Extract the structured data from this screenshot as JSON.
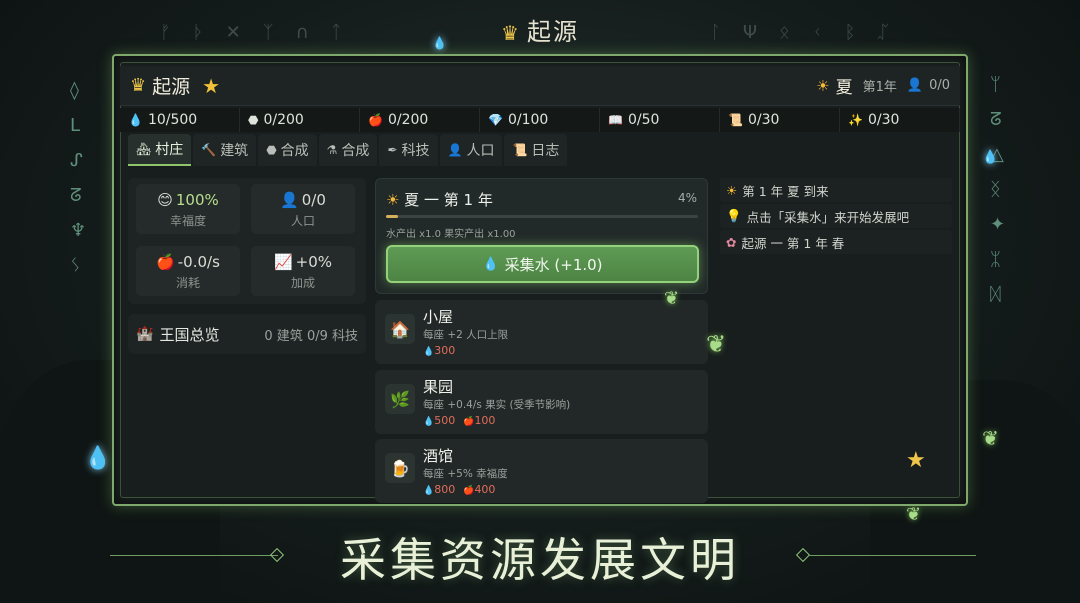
{
  "top": {
    "title": "起源"
  },
  "header": {
    "title": "起源",
    "season": "夏",
    "year": "第1年",
    "population": "0/0"
  },
  "resources": [
    {
      "icon": "water-drop-icon",
      "glyph": "💧",
      "value": "10/500"
    },
    {
      "icon": "stone-icon",
      "glyph": "⬣",
      "value": "0/200"
    },
    {
      "icon": "apple-icon",
      "glyph": "🍎",
      "value": "0/200"
    },
    {
      "icon": "gem-icon",
      "glyph": "💎",
      "value": "0/100"
    },
    {
      "icon": "book-icon",
      "glyph": "📖",
      "value": "0/50"
    },
    {
      "icon": "scroll-icon",
      "glyph": "📜",
      "value": "0/30"
    },
    {
      "icon": "sparkle-icon",
      "glyph": "✨",
      "value": "0/30"
    }
  ],
  "tabs": [
    {
      "label": "村庄",
      "icon": "village-icon"
    },
    {
      "label": "建筑",
      "icon": "hammer-icon"
    },
    {
      "label": "合成",
      "icon": "cauldron-icon"
    },
    {
      "label": "合成",
      "icon": "flask-icon"
    },
    {
      "label": "科技",
      "icon": "quill-icon"
    },
    {
      "label": "人口",
      "icon": "person-icon"
    },
    {
      "label": "日志",
      "icon": "journal-icon"
    }
  ],
  "stats": [
    {
      "value": "100%",
      "label": "幸福度",
      "icon": "smile-icon"
    },
    {
      "value": "0/0",
      "label": "人口",
      "icon": "person-icon"
    },
    {
      "value": "-0.0/s",
      "label": "消耗",
      "icon": "apple-icon"
    },
    {
      "value": "+0%",
      "label": "加成",
      "icon": "trend-icon"
    }
  ],
  "kingdom": {
    "title": "王国总览",
    "summary": "0 建筑  0/9 科技"
  },
  "season_card": {
    "title": "夏 一 第 1 年",
    "percent": "4%",
    "progress": 0.04,
    "production": "水产出 x1.0   果实产出 x1.00",
    "collect_label": "采集水 (+1.0)"
  },
  "buildings": [
    {
      "name": "小屋",
      "desc": "每座 +2 人口上限",
      "icon": "house-icon",
      "glyph": "🏠",
      "costs": [
        {
          "type": "water",
          "value": "300",
          "red": true
        }
      ]
    },
    {
      "name": "果园",
      "desc": "每座 +0.4/s 果实 (受季节影响)",
      "icon": "sprout-icon",
      "glyph": "🌿",
      "costs": [
        {
          "type": "water",
          "value": "500",
          "red": true
        },
        {
          "type": "apple",
          "value": "100",
          "red": true
        }
      ]
    },
    {
      "name": "酒馆",
      "desc": "每座 +5% 幸福度",
      "icon": "beer-icon",
      "glyph": "🍺",
      "costs": [
        {
          "type": "water",
          "value": "800",
          "red": true
        },
        {
          "type": "apple",
          "value": "400",
          "red": true
        }
      ]
    }
  ],
  "log": [
    {
      "icon": "sun-icon",
      "glyph": "☀",
      "text": "第 1 年 夏 到来"
    },
    {
      "icon": "bulb-icon",
      "glyph": "💡",
      "text": "点击「采集水」来开始发展吧"
    },
    {
      "icon": "blossom-icon",
      "glyph": "✿",
      "text": "起源 一 第 1 年 春"
    }
  ],
  "slogan": "采集资源发展文明",
  "colors": {
    "accent": "#8fc46a",
    "gold": "#f0c64a",
    "cost_red": "#e16d5a"
  }
}
